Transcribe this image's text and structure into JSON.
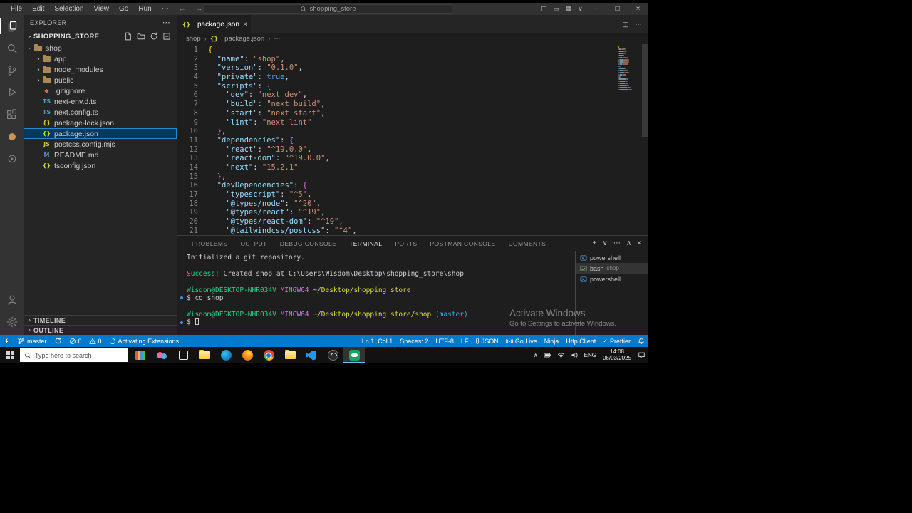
{
  "titlebar": {
    "menu": [
      "File",
      "Edit",
      "Selection",
      "View",
      "Go",
      "Run",
      "⋯"
    ],
    "back": "←",
    "forward": "→",
    "search_text": "shopping_store",
    "layout_icons": [
      "toggle-sidebar",
      "toggle-panel",
      "customize-layout",
      "layout-dropdown"
    ],
    "window": {
      "minimize": "–",
      "maximize": "□",
      "close": "×"
    }
  },
  "activity_bar": {
    "top": [
      "explorer",
      "search",
      "source-control",
      "run-debug",
      "extensions",
      "extension-a",
      "extension-b"
    ],
    "bottom": [
      "account",
      "settings"
    ]
  },
  "explorer": {
    "header": "EXPLORER",
    "header_more": "⋯",
    "section": "SHOPPING_STORE",
    "actions": [
      "new-file",
      "new-folder",
      "refresh",
      "collapse-all"
    ],
    "tree": [
      {
        "label": "shop",
        "icon": "folder",
        "depth": 0,
        "expanded": true
      },
      {
        "label": "app",
        "icon": "folder",
        "depth": 1,
        "expanded": false
      },
      {
        "label": "node_modules",
        "icon": "folder",
        "depth": 1,
        "expanded": false
      },
      {
        "label": "public",
        "icon": "folder",
        "depth": 1,
        "expanded": false
      },
      {
        "label": ".gitignore",
        "icon": "git",
        "depth": 1
      },
      {
        "label": "next-env.d.ts",
        "icon": "ts",
        "depth": 1
      },
      {
        "label": "next.config.ts",
        "icon": "ts",
        "depth": 1
      },
      {
        "label": "package-lock.json",
        "icon": "json",
        "depth": 1
      },
      {
        "label": "package.json",
        "icon": "json",
        "depth": 1,
        "selected": true
      },
      {
        "label": "postcss.config.mjs",
        "icon": "js",
        "depth": 1
      },
      {
        "label": "README.md",
        "icon": "md",
        "depth": 1
      },
      {
        "label": "tsconfig.json",
        "icon": "json",
        "depth": 1
      }
    ],
    "bottom_sections": [
      "TIMELINE",
      "OUTLINE"
    ]
  },
  "editor": {
    "tab": {
      "label": "package.json",
      "icon": "json",
      "close": "×"
    },
    "tab_actions": [
      "split-editor",
      "more"
    ],
    "breadcrumb": [
      "shop",
      "package.json",
      "⋯"
    ],
    "token_colors": {
      "key": "#9cdcfe",
      "str": "#ce9178",
      "kw": "#569cd6",
      "num": "#b5cea8",
      "pun": "#d4d4d4",
      "b1": "#ffd700",
      "b2": "#da70d6"
    },
    "lines": [
      [
        [
          "{",
          "b1"
        ]
      ],
      [
        [
          "  ",
          "pun"
        ],
        [
          "\"name\"",
          "key"
        ],
        [
          ": ",
          "pun"
        ],
        [
          "\"shop\"",
          "str"
        ],
        [
          ",",
          "pun"
        ]
      ],
      [
        [
          "  ",
          "pun"
        ],
        [
          "\"version\"",
          "key"
        ],
        [
          ": ",
          "pun"
        ],
        [
          "\"0.1.0\"",
          "str"
        ],
        [
          ",",
          "pun"
        ]
      ],
      [
        [
          "  ",
          "pun"
        ],
        [
          "\"private\"",
          "key"
        ],
        [
          ": ",
          "pun"
        ],
        [
          "true",
          "kw"
        ],
        [
          ",",
          "pun"
        ]
      ],
      [
        [
          "  ",
          "pun"
        ],
        [
          "\"scripts\"",
          "key"
        ],
        [
          ": ",
          "pun"
        ],
        [
          "{",
          "b2"
        ]
      ],
      [
        [
          "    ",
          "pun"
        ],
        [
          "\"dev\"",
          "key"
        ],
        [
          ": ",
          "pun"
        ],
        [
          "\"next dev\"",
          "str"
        ],
        [
          ",",
          "pun"
        ]
      ],
      [
        [
          "    ",
          "pun"
        ],
        [
          "\"build\"",
          "key"
        ],
        [
          ": ",
          "pun"
        ],
        [
          "\"next build\"",
          "str"
        ],
        [
          ",",
          "pun"
        ]
      ],
      [
        [
          "    ",
          "pun"
        ],
        [
          "\"start\"",
          "key"
        ],
        [
          ": ",
          "pun"
        ],
        [
          "\"next start\"",
          "str"
        ],
        [
          ",",
          "pun"
        ]
      ],
      [
        [
          "    ",
          "pun"
        ],
        [
          "\"lint\"",
          "key"
        ],
        [
          ": ",
          "pun"
        ],
        [
          "\"next lint\"",
          "str"
        ]
      ],
      [
        [
          "  ",
          "pun"
        ],
        [
          "}",
          "b2"
        ],
        [
          ",",
          "pun"
        ]
      ],
      [
        [
          "  ",
          "pun"
        ],
        [
          "\"dependencies\"",
          "key"
        ],
        [
          ": ",
          "pun"
        ],
        [
          "{",
          "b2"
        ]
      ],
      [
        [
          "    ",
          "pun"
        ],
        [
          "\"react\"",
          "key"
        ],
        [
          ": ",
          "pun"
        ],
        [
          "\"^19.0.0\"",
          "str"
        ],
        [
          ",",
          "pun"
        ]
      ],
      [
        [
          "    ",
          "pun"
        ],
        [
          "\"react-dom\"",
          "key"
        ],
        [
          ": ",
          "pun"
        ],
        [
          "\"^19.0.0\"",
          "str"
        ],
        [
          ",",
          "pun"
        ]
      ],
      [
        [
          "    ",
          "pun"
        ],
        [
          "\"next\"",
          "key"
        ],
        [
          ": ",
          "pun"
        ],
        [
          "\"15.2.1\"",
          "str"
        ]
      ],
      [
        [
          "  ",
          "pun"
        ],
        [
          "}",
          "b2"
        ],
        [
          ",",
          "pun"
        ]
      ],
      [
        [
          "  ",
          "pun"
        ],
        [
          "\"devDependencies\"",
          "key"
        ],
        [
          ": ",
          "pun"
        ],
        [
          "{",
          "b2"
        ]
      ],
      [
        [
          "    ",
          "pun"
        ],
        [
          "\"typescript\"",
          "key"
        ],
        [
          ": ",
          "pun"
        ],
        [
          "\"^5\"",
          "str"
        ],
        [
          ",",
          "pun"
        ]
      ],
      [
        [
          "    ",
          "pun"
        ],
        [
          "\"@types/node\"",
          "key"
        ],
        [
          ": ",
          "pun"
        ],
        [
          "\"^20\"",
          "str"
        ],
        [
          ",",
          "pun"
        ]
      ],
      [
        [
          "    ",
          "pun"
        ],
        [
          "\"@types/react\"",
          "key"
        ],
        [
          ": ",
          "pun"
        ],
        [
          "\"^19\"",
          "str"
        ],
        [
          ",",
          "pun"
        ]
      ],
      [
        [
          "    ",
          "pun"
        ],
        [
          "\"@types/react-dom\"",
          "key"
        ],
        [
          ": ",
          "pun"
        ],
        [
          "\"^19\"",
          "str"
        ],
        [
          ",",
          "pun"
        ]
      ],
      [
        [
          "    ",
          "pun"
        ],
        [
          "\"@tailwindcss/postcss\"",
          "key"
        ],
        [
          ": ",
          "pun"
        ],
        [
          "\"^4\"",
          "str"
        ],
        [
          ",",
          "pun"
        ]
      ]
    ]
  },
  "panel": {
    "tabs": [
      {
        "label": "PROBLEMS"
      },
      {
        "label": "OUTPUT"
      },
      {
        "label": "DEBUG CONSOLE"
      },
      {
        "label": "TERMINAL",
        "active": true
      },
      {
        "label": "PORTS"
      },
      {
        "label": "POSTMAN CONSOLE"
      },
      {
        "label": "COMMENTS"
      }
    ],
    "actions": [
      "new-terminal",
      "dropdown",
      "more",
      "maximize",
      "close"
    ],
    "terminal_colors": {
      "tfg": "#cccccc",
      "tgreen": "#23d18b",
      "tpurple": "#d670d6",
      "tyellow": "#dcdc3c",
      "tcyan": "#29b8db"
    },
    "terminal_lines": [
      {
        "s": [
          [
            "Initialized a git repository.",
            "tfg"
          ]
        ]
      },
      {
        "s": []
      },
      {
        "s": [
          [
            "Success!",
            "tgreen"
          ],
          [
            " Created shop at C:\\Users\\Wisdom\\Desktop\\shopping_store\\shop",
            "tfg"
          ]
        ]
      },
      {
        "s": []
      },
      {
        "s": [
          [
            "Wisdom@DESKTOP-NHR034V ",
            "tgreen"
          ],
          [
            "MINGW64 ",
            "tpurple"
          ],
          [
            "~/Desktop/shopping_store",
            "tyellow"
          ]
        ]
      },
      {
        "s": [
          [
            "$ cd shop",
            "tfg"
          ]
        ],
        "bullet": true
      },
      {
        "s": []
      },
      {
        "s": [
          [
            "Wisdom@DESKTOP-NHR034V ",
            "tgreen"
          ],
          [
            "MINGW64 ",
            "tpurple"
          ],
          [
            "~/Desktop/shopping_store/shop ",
            "tyellow"
          ],
          [
            "(master)",
            "tcyan"
          ]
        ]
      },
      {
        "s": [
          [
            "$ ",
            "tfg"
          ]
        ],
        "bullet": true,
        "cursor": true
      }
    ],
    "terminal_list": [
      {
        "icon": "powershell",
        "label": "powershell"
      },
      {
        "icon": "bash",
        "label": "bash",
        "sub": "shop",
        "selected": true
      },
      {
        "icon": "powershell",
        "label": "powershell"
      }
    ]
  },
  "status_bar": {
    "left": [
      {
        "name": "remote",
        "icon": "remote",
        "label": ""
      },
      {
        "name": "git-branch",
        "icon": "branch",
        "label": "master"
      },
      {
        "name": "sync",
        "icon": "sync",
        "label": ""
      },
      {
        "name": "errors",
        "icon": "error",
        "label": "0"
      },
      {
        "name": "warnings",
        "icon": "warning",
        "label": "0"
      },
      {
        "name": "activating-extensions",
        "icon": "spinner",
        "label": "Activating Extensions..."
      }
    ],
    "right": [
      {
        "name": "cursor-position",
        "label": "Ln 1, Col 1"
      },
      {
        "name": "indentation",
        "label": "Spaces: 2"
      },
      {
        "name": "encoding",
        "label": "UTF-8"
      },
      {
        "name": "eol",
        "label": "LF"
      },
      {
        "name": "language-mode",
        "icon": "braces",
        "label": "JSON"
      },
      {
        "name": "go-live",
        "icon": "broadcast",
        "label": "Go Live"
      },
      {
        "name": "ninja",
        "label": "Ninja"
      },
      {
        "name": "http-client",
        "label": "Http Client"
      },
      {
        "name": "prettier",
        "icon": "check",
        "label": "Prettier"
      },
      {
        "name": "notifications",
        "icon": "bell",
        "label": ""
      }
    ]
  },
  "taskbar": {
    "search_placeholder": "Type here to search",
    "apps": [
      "library",
      "people",
      "task-view",
      "file-explorer",
      "edge",
      "firefox",
      "chrome",
      "folder",
      "vscode",
      "obs",
      "recorder"
    ],
    "active_app": "recorder",
    "tray": {
      "icons": [
        "battery",
        "wifi",
        "volume"
      ],
      "lang": "ENG",
      "time": "14:08",
      "date": "06/03/2025"
    }
  },
  "watermark": {
    "line1": "Activate Windows",
    "line2": "Go to Settings to activate Windows."
  }
}
